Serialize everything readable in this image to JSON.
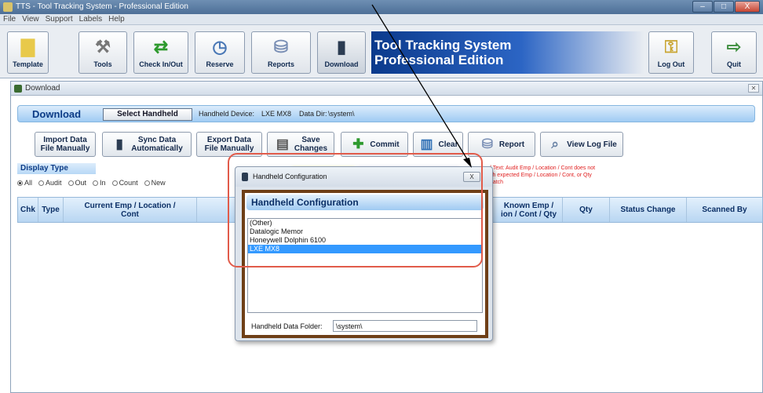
{
  "window": {
    "title": "TTS - Tool Tracking System - Professional Edition",
    "min_glyph": "–",
    "max_glyph": "□",
    "close_glyph": "X"
  },
  "menu": [
    "File",
    "View",
    "Support",
    "Labels",
    "Help"
  ],
  "toolbar": {
    "buttons": [
      {
        "label": "Template",
        "icon": "template-icon"
      },
      {
        "label": "Tools",
        "icon": "tools-icon"
      },
      {
        "label": "Check In/Out",
        "icon": "check-in-out-icon"
      },
      {
        "label": "Reserve",
        "icon": "reserve-icon"
      },
      {
        "label": "Reports",
        "icon": "reports-icon"
      },
      {
        "label": "Download",
        "icon": "handheld-icon"
      },
      {
        "label": "Log Out",
        "icon": "logout-icon"
      },
      {
        "label": "Quit",
        "icon": "quit-icon"
      }
    ],
    "brand_line1": "Tool Tracking System",
    "brand_line2": "Professional Edition"
  },
  "download_window": {
    "title": "Download",
    "header_title": "Download",
    "select_handheld": "Select Handheld",
    "device_label": "Handheld Device:",
    "device_value": "LXE MX8",
    "datadir_label": "Data Dir:",
    "datadir_value": "\\system\\",
    "actions": {
      "import_line1": "Import Data",
      "import_line2": "File Manually",
      "sync_line1": "Sync Data",
      "sync_line2": "Automatically",
      "export_line1": "Export Data",
      "export_line2": "File Manually",
      "save_line1": "Save",
      "save_line2": "Changes",
      "commit": "Commit",
      "clear": "Clear",
      "report": "Report",
      "view_log": "View Log File"
    },
    "display_type": "Display Type",
    "radios": [
      "All",
      "Audit",
      "Out",
      "In",
      "Count",
      "New"
    ],
    "legend_line1": "d Text:  Audit Emp / Location / Cont does not",
    "legend_line2": "tch expected Emp / Location / Cont, or Qty",
    "legend_line3": "match",
    "columns": {
      "chk": "Chk",
      "type": "Type",
      "current_line1": "Current Emp / Location /",
      "current_line2": "Cont",
      "known_line1": "Known Emp /",
      "known_line2": "ion / Cont / Qty",
      "qty": "Qty",
      "status": "Status Change",
      "scanned": "Scanned By"
    }
  },
  "dialog": {
    "title": "Handheld Configuration",
    "close_glyph": "X",
    "heading": "Handheld Configuration",
    "options": [
      "(Other)",
      "Datalogic Memor",
      "Honeywell Dolphin 6100",
      "LXE MX8"
    ],
    "selected_index": 3,
    "folder_label": "Handheld Data Folder:",
    "folder_value": "\\system\\"
  },
  "colors": {
    "annotation": "#e15b4a",
    "brand_blue": "#0b3a8c",
    "header_blue": "#9fcbf3",
    "selection": "#3399ff",
    "dialog_frame": "#6e3f17"
  }
}
